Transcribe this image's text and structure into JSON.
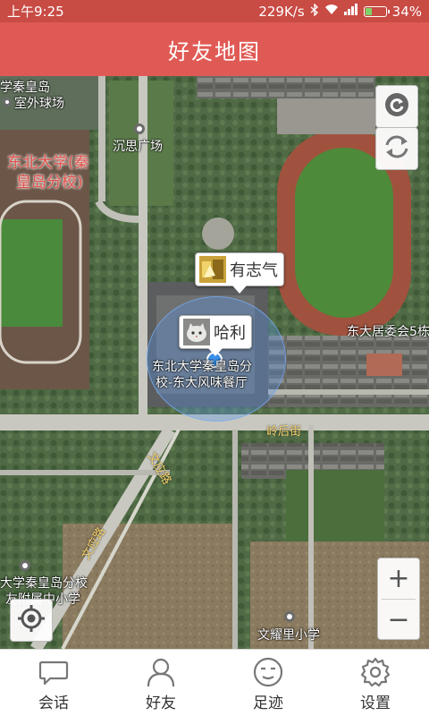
{
  "status_bar": {
    "time": "上午9:25",
    "net_speed": "229K/s",
    "battery_pct": "34%",
    "battery_level": 0.34
  },
  "title_bar": {
    "title": "好友地图"
  },
  "map": {
    "labels": {
      "campus_top_left_1": "学秦皇岛",
      "campus_top_left_2": "室外球场",
      "square": "沉思广场",
      "university_line1": "东北大学(秦",
      "university_line2": "皇岛分校)",
      "restaurant_line1": "东北大学秦皇岛分",
      "restaurant_line2": "校-东大风味餐厅",
      "committee": "东大居委会5栋",
      "street": "岭后街",
      "road1": "文应路",
      "road2": "文应路",
      "school_bl_1": "大学秦皇岛分校",
      "school_bl_2": "友附属中小学",
      "school_br": "文耀里小学"
    },
    "friends": [
      {
        "name": "有志气",
        "avatar_icon": "gold-avatar-icon"
      },
      {
        "name": "哈利",
        "avatar_icon": "cat-avatar-icon"
      }
    ],
    "controls": {
      "refresh_icon": "refresh-icon",
      "sync_icon": "sync-icon",
      "zoom_in": "+",
      "zoom_out": "−",
      "locate_icon": "locate-icon"
    }
  },
  "bottom_nav": {
    "items": [
      {
        "label": "会话",
        "icon": "chat-bubble-icon"
      },
      {
        "label": "好友",
        "icon": "person-icon"
      },
      {
        "label": "足迹",
        "icon": "smile-icon"
      },
      {
        "label": "设置",
        "icon": "gear-icon"
      }
    ]
  },
  "colors": {
    "status_bar": "#c84b44",
    "title_bar": "#e05a55",
    "map_label_red": "#e0524a",
    "location_blue": "#3a8fe8"
  }
}
